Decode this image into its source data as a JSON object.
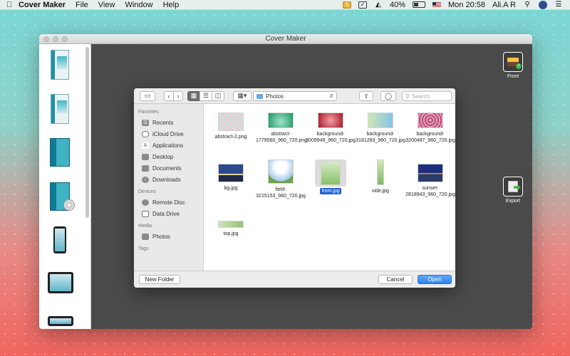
{
  "menubar": {
    "app_name": "Cover Maker",
    "menus": [
      "File",
      "View",
      "Window",
      "Help"
    ],
    "battery": "40%",
    "clock": "Mon 20:58",
    "user": "Ali.A R"
  },
  "window": {
    "title": "Cover Maker",
    "tools": [
      {
        "label": "Front",
        "icon": "image-add-icon"
      },
      {
        "label": "Export",
        "icon": "export-icon"
      }
    ]
  },
  "dialog": {
    "location": "Photos",
    "search_placeholder": "Search",
    "sidebar": {
      "favorites_header": "Favorites",
      "favorites": [
        "Recents",
        "iCloud Drive",
        "Applications",
        "Desktop",
        "Documents",
        "Downloads"
      ],
      "devices_header": "Devices",
      "devices": [
        "Remote Disc",
        "Data Drive"
      ],
      "media_header": "Media",
      "media": [
        "Photos"
      ],
      "tags_header": "Tags"
    },
    "files": [
      {
        "name": "abstract-2.png"
      },
      {
        "name": "abstract-1779560_960_720.png"
      },
      {
        "name": "background-3009949_960_720.jpg"
      },
      {
        "name": "background-3181283_960_720.jpg"
      },
      {
        "name": "background-3200497_960_720.jpg"
      },
      {
        "name": "bg.jpg"
      },
      {
        "name": "field-3215153_960_720.jpg"
      },
      {
        "name": "front.jpg"
      },
      {
        "name": "side.jpg"
      },
      {
        "name": "sunset-2818943_960_720.jpg"
      },
      {
        "name": "top.jpg"
      }
    ],
    "new_folder_label": "New Folder",
    "cancel_label": "Cancel",
    "open_label": "Open"
  },
  "colors": {
    "accent": "#2a83ef",
    "selection": "#1b62d1"
  }
}
